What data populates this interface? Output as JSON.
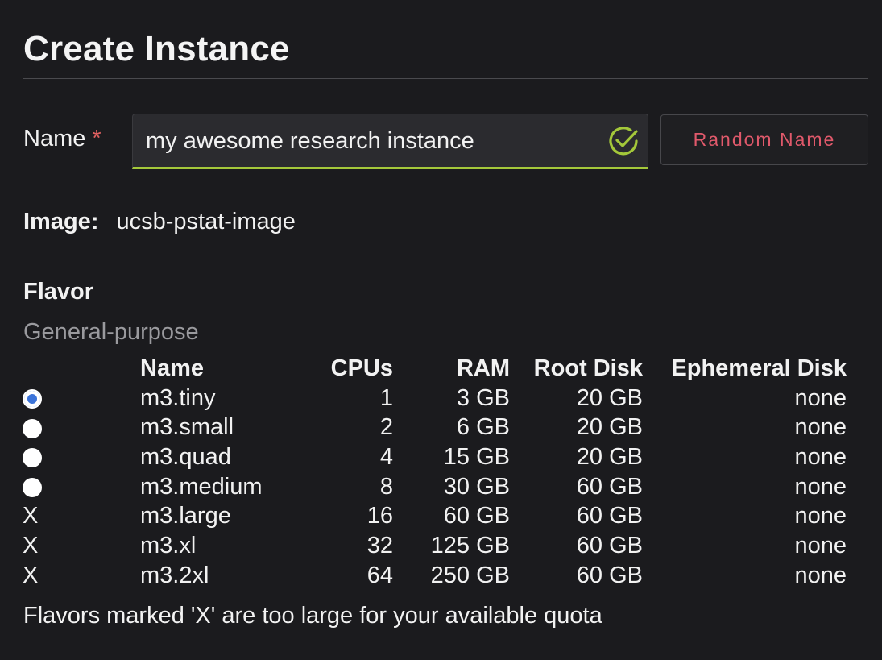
{
  "page": {
    "title": "Create Instance"
  },
  "name_field": {
    "label": "Name",
    "required_mark": "*",
    "value": "my awesome research instance",
    "valid": true
  },
  "random_name_button": "Random Name",
  "image": {
    "label": "Image:",
    "value": "ucsb-pstat-image"
  },
  "flavor": {
    "heading": "Flavor",
    "group": "General-purpose",
    "columns": [
      "Name",
      "CPUs",
      "RAM",
      "Root Disk",
      "Ephemeral Disk"
    ],
    "rows": [
      {
        "selector": "radio",
        "selected": true,
        "name": "m3.tiny",
        "cpus": "1",
        "ram": "3 GB",
        "root_disk": "20 GB",
        "ephemeral_disk": "none"
      },
      {
        "selector": "radio",
        "selected": false,
        "name": "m3.small",
        "cpus": "2",
        "ram": "6 GB",
        "root_disk": "20 GB",
        "ephemeral_disk": "none"
      },
      {
        "selector": "radio",
        "selected": false,
        "name": "m3.quad",
        "cpus": "4",
        "ram": "15 GB",
        "root_disk": "20 GB",
        "ephemeral_disk": "none"
      },
      {
        "selector": "radio",
        "selected": false,
        "name": "m3.medium",
        "cpus": "8",
        "ram": "30 GB",
        "root_disk": "60 GB",
        "ephemeral_disk": "none"
      },
      {
        "selector": "X",
        "selected": false,
        "name": "m3.large",
        "cpus": "16",
        "ram": "60 GB",
        "root_disk": "60 GB",
        "ephemeral_disk": "none"
      },
      {
        "selector": "X",
        "selected": false,
        "name": "m3.xl",
        "cpus": "32",
        "ram": "125 GB",
        "root_disk": "60 GB",
        "ephemeral_disk": "none"
      },
      {
        "selector": "X",
        "selected": false,
        "name": "m3.2xl",
        "cpus": "64",
        "ram": "250 GB",
        "root_disk": "60 GB",
        "ephemeral_disk": "none"
      }
    ],
    "footnote": "Flavors marked 'X' are too large for your available quota"
  },
  "colors": {
    "background": "#1b1b1e",
    "valid_accent": "#a4c83a",
    "danger_text": "#e0596b",
    "radio_selected": "#3b73d9"
  }
}
